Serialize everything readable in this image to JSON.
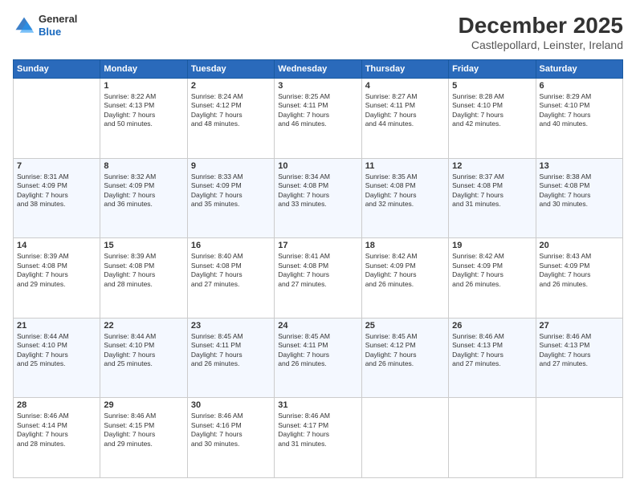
{
  "header": {
    "logo_line1": "General",
    "logo_line2": "Blue",
    "month_title": "December 2025",
    "location": "Castlepollard, Leinster, Ireland"
  },
  "days_of_week": [
    "Sunday",
    "Monday",
    "Tuesday",
    "Wednesday",
    "Thursday",
    "Friday",
    "Saturday"
  ],
  "weeks": [
    [
      {
        "day": "",
        "text": ""
      },
      {
        "day": "1",
        "text": "Sunrise: 8:22 AM\nSunset: 4:13 PM\nDaylight: 7 hours\nand 50 minutes."
      },
      {
        "day": "2",
        "text": "Sunrise: 8:24 AM\nSunset: 4:12 PM\nDaylight: 7 hours\nand 48 minutes."
      },
      {
        "day": "3",
        "text": "Sunrise: 8:25 AM\nSunset: 4:11 PM\nDaylight: 7 hours\nand 46 minutes."
      },
      {
        "day": "4",
        "text": "Sunrise: 8:27 AM\nSunset: 4:11 PM\nDaylight: 7 hours\nand 44 minutes."
      },
      {
        "day": "5",
        "text": "Sunrise: 8:28 AM\nSunset: 4:10 PM\nDaylight: 7 hours\nand 42 minutes."
      },
      {
        "day": "6",
        "text": "Sunrise: 8:29 AM\nSunset: 4:10 PM\nDaylight: 7 hours\nand 40 minutes."
      }
    ],
    [
      {
        "day": "7",
        "text": "Sunrise: 8:31 AM\nSunset: 4:09 PM\nDaylight: 7 hours\nand 38 minutes."
      },
      {
        "day": "8",
        "text": "Sunrise: 8:32 AM\nSunset: 4:09 PM\nDaylight: 7 hours\nand 36 minutes."
      },
      {
        "day": "9",
        "text": "Sunrise: 8:33 AM\nSunset: 4:09 PM\nDaylight: 7 hours\nand 35 minutes."
      },
      {
        "day": "10",
        "text": "Sunrise: 8:34 AM\nSunset: 4:08 PM\nDaylight: 7 hours\nand 33 minutes."
      },
      {
        "day": "11",
        "text": "Sunrise: 8:35 AM\nSunset: 4:08 PM\nDaylight: 7 hours\nand 32 minutes."
      },
      {
        "day": "12",
        "text": "Sunrise: 8:37 AM\nSunset: 4:08 PM\nDaylight: 7 hours\nand 31 minutes."
      },
      {
        "day": "13",
        "text": "Sunrise: 8:38 AM\nSunset: 4:08 PM\nDaylight: 7 hours\nand 30 minutes."
      }
    ],
    [
      {
        "day": "14",
        "text": "Sunrise: 8:39 AM\nSunset: 4:08 PM\nDaylight: 7 hours\nand 29 minutes."
      },
      {
        "day": "15",
        "text": "Sunrise: 8:39 AM\nSunset: 4:08 PM\nDaylight: 7 hours\nand 28 minutes."
      },
      {
        "day": "16",
        "text": "Sunrise: 8:40 AM\nSunset: 4:08 PM\nDaylight: 7 hours\nand 27 minutes."
      },
      {
        "day": "17",
        "text": "Sunrise: 8:41 AM\nSunset: 4:08 PM\nDaylight: 7 hours\nand 27 minutes."
      },
      {
        "day": "18",
        "text": "Sunrise: 8:42 AM\nSunset: 4:09 PM\nDaylight: 7 hours\nand 26 minutes."
      },
      {
        "day": "19",
        "text": "Sunrise: 8:42 AM\nSunset: 4:09 PM\nDaylight: 7 hours\nand 26 minutes."
      },
      {
        "day": "20",
        "text": "Sunrise: 8:43 AM\nSunset: 4:09 PM\nDaylight: 7 hours\nand 26 minutes."
      }
    ],
    [
      {
        "day": "21",
        "text": "Sunrise: 8:44 AM\nSunset: 4:10 PM\nDaylight: 7 hours\nand 25 minutes."
      },
      {
        "day": "22",
        "text": "Sunrise: 8:44 AM\nSunset: 4:10 PM\nDaylight: 7 hours\nand 25 minutes."
      },
      {
        "day": "23",
        "text": "Sunrise: 8:45 AM\nSunset: 4:11 PM\nDaylight: 7 hours\nand 26 minutes."
      },
      {
        "day": "24",
        "text": "Sunrise: 8:45 AM\nSunset: 4:11 PM\nDaylight: 7 hours\nand 26 minutes."
      },
      {
        "day": "25",
        "text": "Sunrise: 8:45 AM\nSunset: 4:12 PM\nDaylight: 7 hours\nand 26 minutes."
      },
      {
        "day": "26",
        "text": "Sunrise: 8:46 AM\nSunset: 4:13 PM\nDaylight: 7 hours\nand 27 minutes."
      },
      {
        "day": "27",
        "text": "Sunrise: 8:46 AM\nSunset: 4:13 PM\nDaylight: 7 hours\nand 27 minutes."
      }
    ],
    [
      {
        "day": "28",
        "text": "Sunrise: 8:46 AM\nSunset: 4:14 PM\nDaylight: 7 hours\nand 28 minutes."
      },
      {
        "day": "29",
        "text": "Sunrise: 8:46 AM\nSunset: 4:15 PM\nDaylight: 7 hours\nand 29 minutes."
      },
      {
        "day": "30",
        "text": "Sunrise: 8:46 AM\nSunset: 4:16 PM\nDaylight: 7 hours\nand 30 minutes."
      },
      {
        "day": "31",
        "text": "Sunrise: 8:46 AM\nSunset: 4:17 PM\nDaylight: 7 hours\nand 31 minutes."
      },
      {
        "day": "",
        "text": ""
      },
      {
        "day": "",
        "text": ""
      },
      {
        "day": "",
        "text": ""
      }
    ]
  ]
}
